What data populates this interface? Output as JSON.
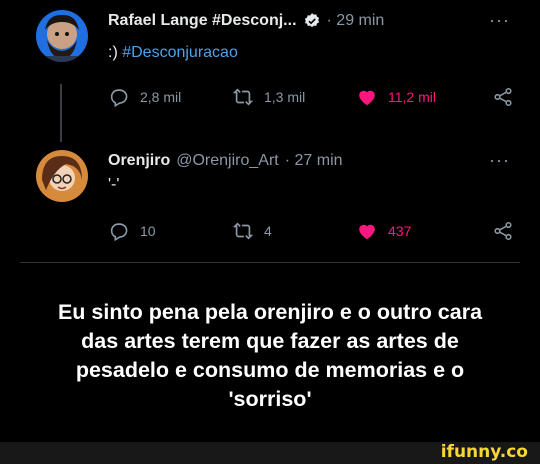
{
  "tweet1": {
    "name": "Rafael Lange #Desconj...",
    "time": "· 29 min",
    "text_prefix": ":) ",
    "hashtag": "#Desconjuracao",
    "more": "···",
    "replies": "2,8 mil",
    "retweets": "1,3 mil",
    "likes": "11,2 mil"
  },
  "tweet2": {
    "name": "Orenjiro",
    "handle": "@Orenjiro_Art",
    "time": "· 27 min",
    "text": "'-'",
    "more": "···",
    "replies": "10",
    "retweets": "4",
    "likes": "437"
  },
  "caption": [
    "Eu sinto pena pela orenjiro e o outro cara",
    "das artes terem que fazer as artes de",
    "pesadelo e consumo de memorias e o",
    "'sorriso'"
  ],
  "watermark": "ifunny.co",
  "colors": {
    "accent": "#4aa3ec",
    "like": "#f91880",
    "muted": "#8b98a5"
  }
}
